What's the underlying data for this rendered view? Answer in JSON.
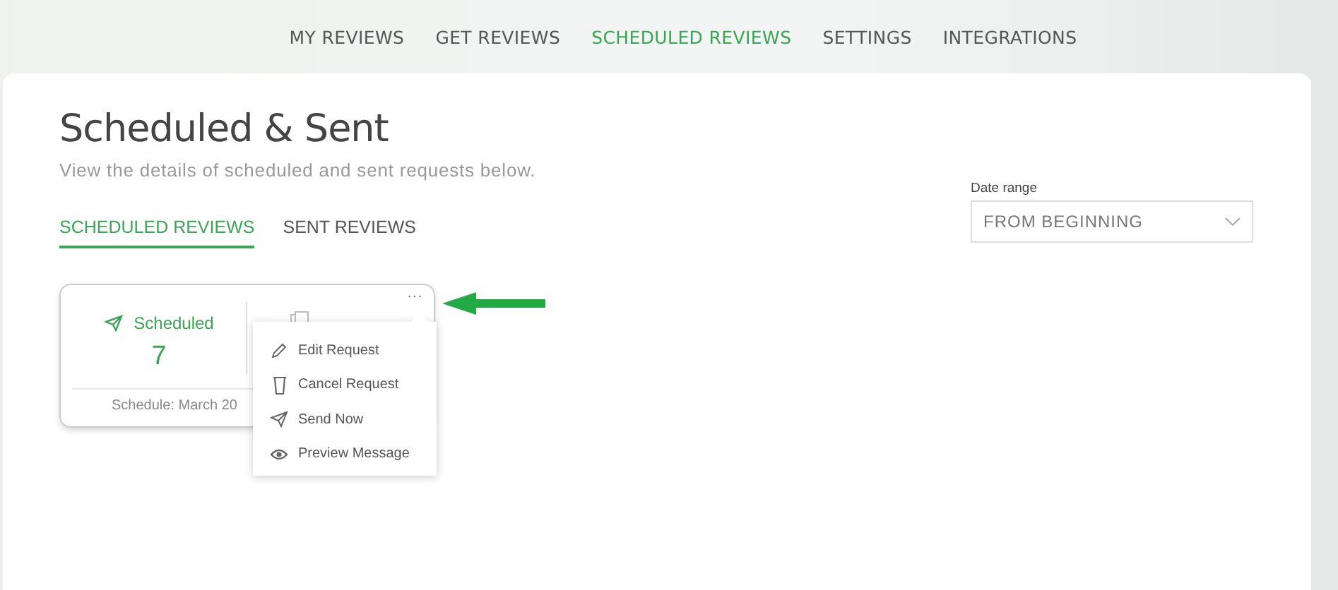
{
  "nav": [
    {
      "label": "MY REVIEWS",
      "selected": false
    },
    {
      "label": "GET REVIEWS",
      "selected": false
    },
    {
      "label": "SCHEDULED REVIEWS",
      "selected": true
    },
    {
      "label": "SETTINGS",
      "selected": false
    },
    {
      "label": "INTEGRATIONS",
      "selected": false
    }
  ],
  "page": {
    "title": "Scheduled & Sent",
    "subtitle": "View the details of scheduled and sent requests below."
  },
  "tabs": [
    {
      "label": "SCHEDULED REVIEWS",
      "selected": true
    },
    {
      "label": "SENT REVIEWS",
      "selected": false
    }
  ],
  "date_range": {
    "label": "Date range",
    "value": "FROM BEGINNING"
  },
  "card": {
    "scheduled_label": "Scheduled",
    "scheduled_count": "7",
    "footer": "Schedule: March 20",
    "more": "···"
  },
  "menu": [
    {
      "kind": "edit",
      "label": "Edit Request"
    },
    {
      "kind": "cancel",
      "label": "Cancel Request"
    },
    {
      "kind": "send",
      "label": "Send Now"
    },
    {
      "kind": "preview",
      "label": "Preview Message"
    }
  ]
}
